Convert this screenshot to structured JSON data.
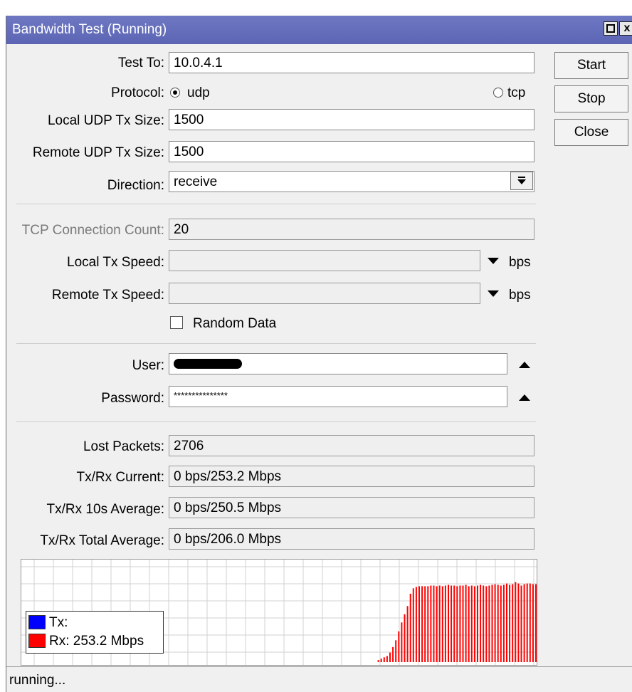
{
  "window": {
    "title": "Bandwidth Test (Running)",
    "close_glyph": "x"
  },
  "buttons": {
    "start": "Start",
    "stop": "Stop",
    "close": "Close"
  },
  "form": {
    "test_to": {
      "label": "Test To:",
      "value": "10.0.4.1"
    },
    "protocol": {
      "label": "Protocol:",
      "options": [
        "udp",
        "tcp"
      ],
      "selected": "udp"
    },
    "local_udp_tx_size": {
      "label": "Local UDP Tx Size:",
      "value": "1500"
    },
    "remote_udp_tx_size": {
      "label": "Remote UDP Tx Size:",
      "value": "1500"
    },
    "direction": {
      "label": "Direction:",
      "value": "receive"
    },
    "tcp_connection_count": {
      "label": "TCP Connection Count:",
      "value": "20"
    },
    "local_tx_speed": {
      "label": "Local Tx Speed:",
      "value": "",
      "unit": "bps"
    },
    "remote_tx_speed": {
      "label": "Remote Tx Speed:",
      "value": "",
      "unit": "bps"
    },
    "random_data": {
      "label": "Random Data",
      "checked": false
    },
    "user": {
      "label": "User:"
    },
    "password": {
      "label": "Password:",
      "value": "***************"
    }
  },
  "stats": {
    "lost_packets": {
      "label": "Lost Packets:",
      "value": "2706"
    },
    "current": {
      "label": "Tx/Rx Current:",
      "value": "0 bps/253.2 Mbps"
    },
    "avg10": {
      "label": "Tx/Rx 10s Average:",
      "value": "0 bps/250.5 Mbps"
    },
    "total_avg": {
      "label": "Tx/Rx Total Average:",
      "value": "0 bps/206.0 Mbps"
    }
  },
  "graph": {
    "legend": {
      "tx": "Tx:",
      "rx": "Rx:  253.2 Mbps"
    },
    "colors": {
      "tx": "#0000ff",
      "rx": "#ff0000",
      "grid": "#d0d0d0"
    },
    "rx_levels": [
      3,
      5,
      7,
      9,
      14,
      22,
      32,
      45,
      58,
      70,
      82,
      100,
      108,
      110,
      111,
      111,
      111,
      111,
      112,
      112,
      111,
      112,
      111,
      112,
      113,
      112,
      112,
      111,
      112,
      112,
      113,
      111,
      112,
      111,
      112,
      113,
      112,
      111,
      112,
      113,
      114,
      113,
      112,
      113,
      115,
      113,
      114,
      117,
      115,
      112,
      114,
      115,
      115,
      114,
      114
    ],
    "tx_levels": []
  },
  "status": {
    "text": "running..."
  }
}
